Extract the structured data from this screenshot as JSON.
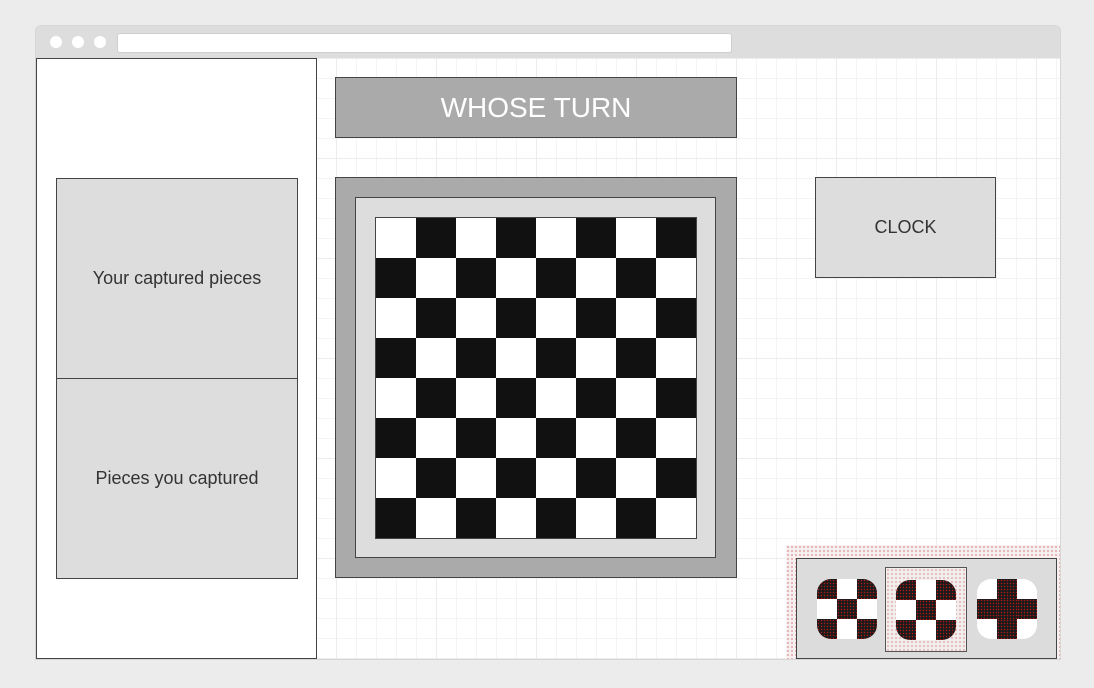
{
  "header": {
    "turn_label": "WHOSE TURN"
  },
  "sidebar": {
    "your_captured_label": "Your captured pieces",
    "pieces_you_captured_label": "Pieces you captured"
  },
  "clock": {
    "label": "CLOCK"
  },
  "board": {
    "size": 8,
    "light_color": "#ffffff",
    "dark_color": "#111111",
    "first_square": "light"
  },
  "theme_selector": {
    "options": [
      {
        "icon": "checkerboard-theme-icon",
        "pattern": "dark-center-light"
      },
      {
        "icon": "checkerboard-theme-icon",
        "pattern": "dark-center-dark",
        "selected": true
      },
      {
        "icon": "checkerboard-theme-icon",
        "pattern": "dark-center-dark"
      }
    ]
  },
  "colors": {
    "panel_gray": "#dddddd",
    "banner_gray": "#aaaaaa",
    "border": "#444444"
  }
}
